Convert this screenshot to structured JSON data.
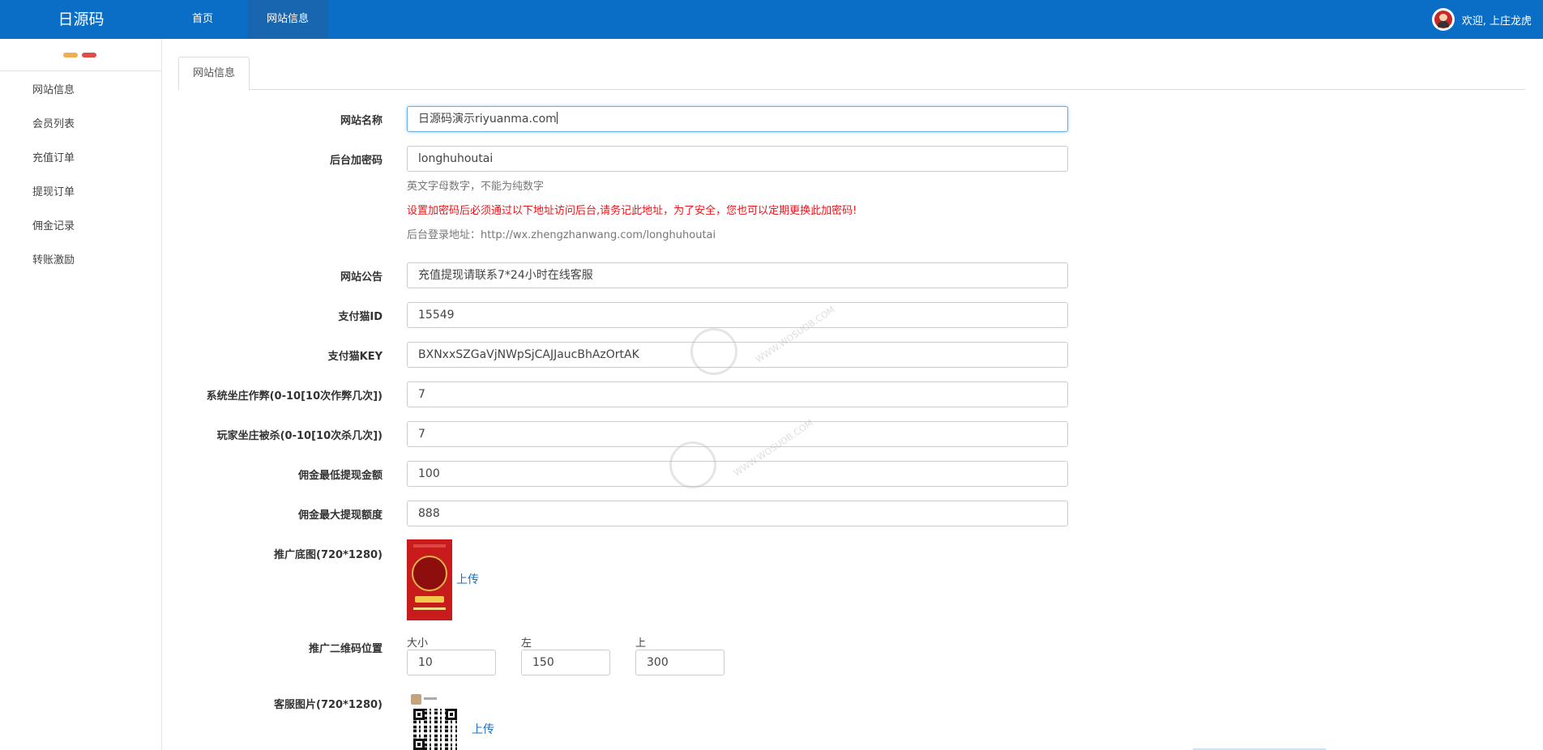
{
  "header": {
    "brand": "日源码",
    "nav": [
      {
        "label": "首页"
      },
      {
        "label": "网站信息"
      }
    ],
    "user_greeting": "欢迎, 上庄龙虎"
  },
  "sidebar": {
    "items": [
      {
        "label": "网站信息"
      },
      {
        "label": "会员列表"
      },
      {
        "label": "充值订单"
      },
      {
        "label": "提现订单"
      },
      {
        "label": "佣金记录"
      },
      {
        "label": "转账激励"
      }
    ]
  },
  "tabs": [
    {
      "label": "网站信息"
    }
  ],
  "form": {
    "site_name": {
      "label": "网站名称",
      "value": "日源码演示riyuanma.com"
    },
    "admin_key": {
      "label": "后台加密码",
      "value": "longhuhoutai",
      "help": "英文字母数字，不能为纯数字",
      "warning": "设置加密码后必须通过以下地址访问后台,请务记此地址，为了安全，您也可以定期更换此加密码!",
      "login_url": "后台登录地址：http://wx.zhengzhanwang.com/longhuhoutai"
    },
    "notice": {
      "label": "网站公告",
      "value": "充值提现请联系7*24小时在线客服"
    },
    "pay_id": {
      "label": "支付猫ID",
      "value": "15549"
    },
    "pay_key": {
      "label": "支付猫KEY",
      "value": "BXNxxSZGaVjNWpSjCAJJaucBhAzOrtAK"
    },
    "sys_banker_cheat": {
      "label": "系统坐庄作弊(0-10[10次作弊几次])",
      "value": "7"
    },
    "player_banker_kill": {
      "label": "玩家坐庄被杀(0-10[10次杀几次])",
      "value": "7"
    },
    "min_withdraw": {
      "label": "佣金最低提现金额",
      "value": "100"
    },
    "max_withdraw": {
      "label": "佣金最大提现额度",
      "value": "888"
    },
    "promo_bg": {
      "label": "推广底图(720*1280)",
      "upload": "上传"
    },
    "qr_position": {
      "label": "推广二维码位置",
      "fields": [
        {
          "label": "大小",
          "value": "10"
        },
        {
          "label": "左",
          "value": "150"
        },
        {
          "label": "上",
          "value": "300"
        }
      ]
    },
    "service_img": {
      "label": "客服图片(720*1280)",
      "upload": "上传"
    }
  },
  "watermark": {
    "text": "WWW.WOSUOB.COM"
  }
}
